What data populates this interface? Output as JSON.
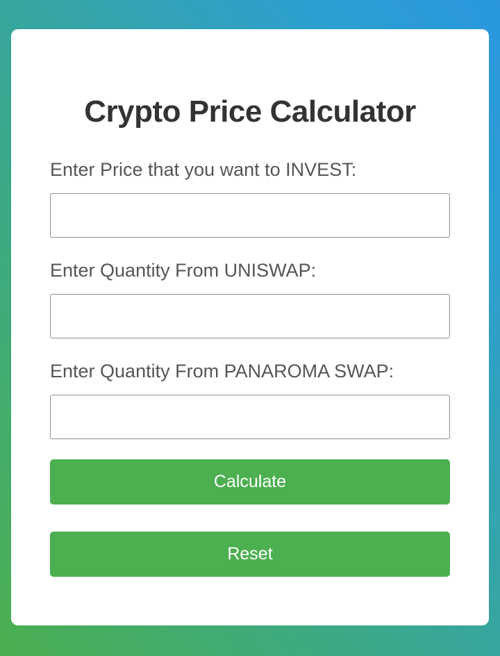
{
  "page": {
    "title": "Crypto Price Calculator"
  },
  "form": {
    "invest_label": "Enter Price that you want to INVEST:",
    "invest_value": "",
    "uniswap_label": "Enter Quantity From UNISWAP:",
    "uniswap_value": "",
    "panaroma_label": "Enter Quantity From PANAROMA SWAP:",
    "panaroma_value": ""
  },
  "actions": {
    "calculate_label": "Calculate",
    "reset_label": "Reset"
  },
  "colors": {
    "button_bg": "#4caf50",
    "background_start": "#4caf50",
    "background_end": "#2a97df",
    "title_text": "#333333"
  }
}
